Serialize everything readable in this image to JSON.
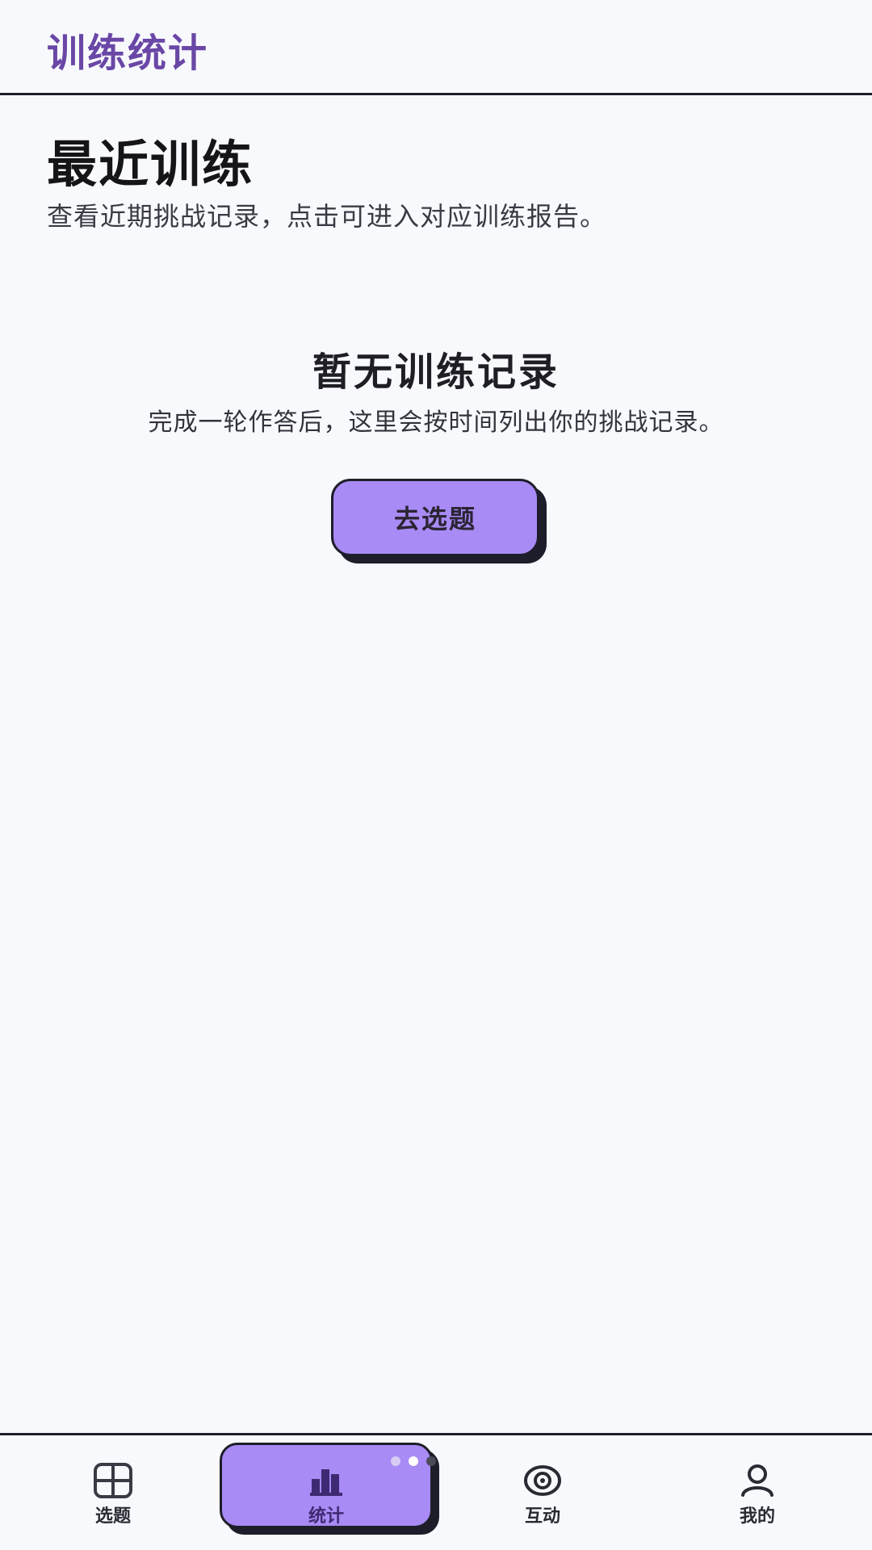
{
  "header": {
    "title": "训练统计"
  },
  "section": {
    "title": "最近训练",
    "description": "查看近期挑战记录，点击可进入对应训练报告。"
  },
  "empty_state": {
    "title": "暂无训练记录",
    "description": "完成一轮作答后，这里会按时间列出你的挑战记录。",
    "button_label": "去选题"
  },
  "tabbar": {
    "active": "统计",
    "items": [
      {
        "label": "选题",
        "icon": "grid-icon"
      },
      {
        "label": "统计",
        "icon": "bar-chart-icon"
      },
      {
        "label": "互动",
        "icon": "eye-icon"
      },
      {
        "label": "我的",
        "icon": "user-icon"
      }
    ]
  },
  "colors": {
    "accent": "#A88BF5",
    "brand_title": "#6A47A6",
    "ink": "#1E1E2A",
    "background": "#F8F9FD"
  }
}
